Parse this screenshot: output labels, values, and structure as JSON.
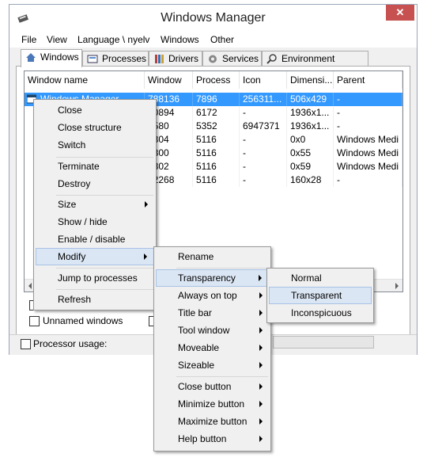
{
  "window": {
    "title": "Windows Manager",
    "close_glyph": "✕"
  },
  "menubar": [
    "File",
    "View",
    "Language \\ nyelv",
    "Windows",
    "Other"
  ],
  "tabs": [
    "Windows",
    "Processes",
    "Drivers",
    "Services",
    "Environment variables"
  ],
  "list": {
    "headers": [
      "Window name",
      "Window",
      "Process",
      "Icon",
      "Dimensi...",
      "Parent"
    ],
    "rows": [
      [
        "Windows Manager",
        "788136",
        "7896",
        "256311...",
        "506x429",
        "-"
      ],
      [
        "",
        "90894",
        "6172",
        "-",
        "1936x1...",
        "-"
      ],
      [
        "",
        "6580",
        "5352",
        "6947371",
        "1936x1...",
        "-"
      ],
      [
        "",
        "6804",
        "5116",
        "-",
        "0x0",
        "Windows Medi"
      ],
      [
        "",
        "6800",
        "5116",
        "-",
        "0x55",
        "Windows Medi"
      ],
      [
        "",
        "6802",
        "5116",
        "-",
        "0x59",
        "Windows Medi"
      ],
      [
        "",
        "32268",
        "5116",
        "-",
        "160x28",
        "-"
      ]
    ]
  },
  "bottom": {
    "unnamed_windows": "Unnamed windows",
    "processor_usage": "Processor usage:"
  },
  "context_menu": {
    "items": [
      "Close",
      "Close structure",
      "Switch",
      "Terminate",
      "Destroy",
      "Size",
      "Show / hide",
      "Enable / disable",
      "Modify",
      "Jump to processes",
      "Refresh"
    ]
  },
  "modify_menu": {
    "items": [
      "Rename",
      "Transparency",
      "Always on top",
      "Title bar",
      "Tool window",
      "Moveable",
      "Sizeable",
      "Close button",
      "Minimize button",
      "Maximize button",
      "Help button"
    ]
  },
  "transparency_menu": {
    "items": [
      "Normal",
      "Transparent",
      "Inconspicuous"
    ]
  },
  "colors": {
    "selection": "#3399ff",
    "menu_highlight": "#dbe6f4",
    "close_button": "#c75050"
  }
}
